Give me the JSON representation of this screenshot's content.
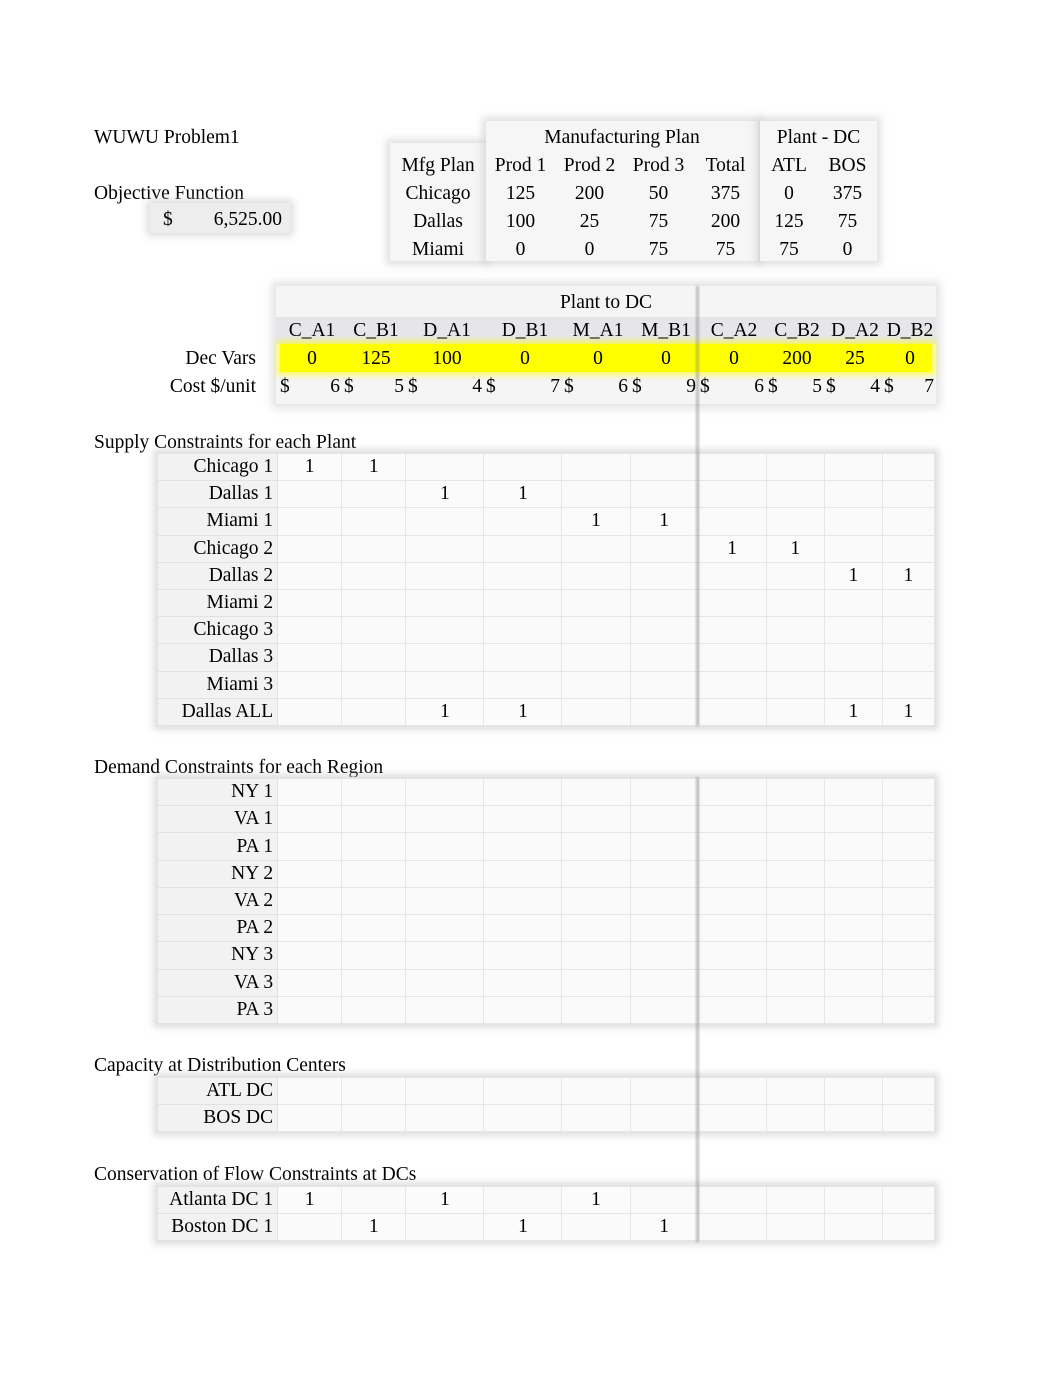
{
  "document": {
    "title": "WUWU Problem1",
    "objective_label": "Objective Function",
    "objective_currency": "$",
    "objective_value": "6,525.00"
  },
  "manufacturing": {
    "group_title": "Manufacturing Plan",
    "plant_dc_title": "Plant - DC",
    "headers": [
      "Mfg Plan",
      "Prod 1",
      "Prod 2",
      "Prod 3",
      "Total",
      "ATL",
      "BOS"
    ],
    "rows": [
      {
        "plant": "Chicago",
        "prod1": "125",
        "prod2": "200",
        "prod3": "50",
        "total": "375",
        "atl": "0",
        "bos": "375"
      },
      {
        "plant": "Dallas",
        "prod1": "100",
        "prod2": "25",
        "prod3": "75",
        "total": "200",
        "atl": "125",
        "bos": "75"
      },
      {
        "plant": "Miami",
        "prod1": "0",
        "prod2": "0",
        "prod3": "75",
        "total": "75",
        "atl": "75",
        "bos": "0"
      }
    ]
  },
  "plant_to_dc": {
    "group_title": "Plant to DC",
    "columns": [
      "C_A1",
      "C_B1",
      "D_A1",
      "D_B1",
      "M_A1",
      "M_B1",
      "C_A2",
      "C_B2",
      "D_A2",
      "D_B2"
    ],
    "dec_vars_label": "Dec Vars",
    "dec_vars": [
      "0",
      "125",
      "100",
      "0",
      "0",
      "0",
      "0",
      "200",
      "25",
      "0"
    ],
    "cost_label": "Cost $/unit",
    "cost_currency": "$",
    "costs": [
      "6",
      "5",
      "4",
      "7",
      "6",
      "9",
      "6",
      "5",
      "4",
      "7"
    ],
    "highlight_color": "#ffff00"
  },
  "supply": {
    "title": "Supply Constraints for each Plant",
    "rows": [
      {
        "label": "Chicago 1",
        "cells": [
          "1",
          "1",
          "",
          "",
          "",
          "",
          "",
          "",
          "",
          ""
        ]
      },
      {
        "label": "Dallas 1",
        "cells": [
          "",
          "",
          "1",
          "1",
          "",
          "",
          "",
          "",
          "",
          ""
        ]
      },
      {
        "label": "Miami 1",
        "cells": [
          "",
          "",
          "",
          "",
          "1",
          "1",
          "",
          "",
          "",
          ""
        ]
      },
      {
        "label": "Chicago 2",
        "cells": [
          "",
          "",
          "",
          "",
          "",
          "",
          "1",
          "1",
          "",
          ""
        ]
      },
      {
        "label": "Dallas 2",
        "cells": [
          "",
          "",
          "",
          "",
          "",
          "",
          "",
          "",
          "1",
          "1"
        ]
      },
      {
        "label": "Miami 2",
        "cells": [
          "",
          "",
          "",
          "",
          "",
          "",
          "",
          "",
          "",
          ""
        ]
      },
      {
        "label": "Chicago 3",
        "cells": [
          "",
          "",
          "",
          "",
          "",
          "",
          "",
          "",
          "",
          ""
        ]
      },
      {
        "label": "Dallas 3",
        "cells": [
          "",
          "",
          "",
          "",
          "",
          "",
          "",
          "",
          "",
          ""
        ]
      },
      {
        "label": "Miami 3",
        "cells": [
          "",
          "",
          "",
          "",
          "",
          "",
          "",
          "",
          "",
          ""
        ]
      },
      {
        "label": "Dallas ALL",
        "cells": [
          "",
          "",
          "1",
          "1",
          "",
          "",
          "",
          "",
          "1",
          "1"
        ]
      }
    ]
  },
  "demand": {
    "title": "Demand Constraints for each Region",
    "rows": [
      {
        "label": "NY 1",
        "cells": [
          "",
          "",
          "",
          "",
          "",
          "",
          "",
          "",
          "",
          ""
        ]
      },
      {
        "label": "VA  1",
        "cells": [
          "",
          "",
          "",
          "",
          "",
          "",
          "",
          "",
          "",
          ""
        ]
      },
      {
        "label": "PA 1",
        "cells": [
          "",
          "",
          "",
          "",
          "",
          "",
          "",
          "",
          "",
          ""
        ]
      },
      {
        "label": "NY 2",
        "cells": [
          "",
          "",
          "",
          "",
          "",
          "",
          "",
          "",
          "",
          ""
        ]
      },
      {
        "label": "VA  2",
        "cells": [
          "",
          "",
          "",
          "",
          "",
          "",
          "",
          "",
          "",
          ""
        ]
      },
      {
        "label": "PA 2",
        "cells": [
          "",
          "",
          "",
          "",
          "",
          "",
          "",
          "",
          "",
          ""
        ]
      },
      {
        "label": "NY 3",
        "cells": [
          "",
          "",
          "",
          "",
          "",
          "",
          "",
          "",
          "",
          ""
        ]
      },
      {
        "label": "VA  3",
        "cells": [
          "",
          "",
          "",
          "",
          "",
          "",
          "",
          "",
          "",
          ""
        ]
      },
      {
        "label": "PA 3",
        "cells": [
          "",
          "",
          "",
          "",
          "",
          "",
          "",
          "",
          "",
          ""
        ]
      }
    ]
  },
  "capacity": {
    "title": "Capacity at Distribution Centers",
    "rows": [
      {
        "label": "ATL DC",
        "cells": [
          "",
          "",
          "",
          "",
          "",
          "",
          "",
          "",
          "",
          ""
        ]
      },
      {
        "label": "BOS DC",
        "cells": [
          "",
          "",
          "",
          "",
          "",
          "",
          "",
          "",
          "",
          ""
        ]
      }
    ]
  },
  "conservation": {
    "title": "Conservation of Flow Constraints at DCs",
    "rows": [
      {
        "label": "Atlanta DC 1",
        "cells": [
          "1",
          "",
          "1",
          "",
          "1",
          "",
          "",
          "",
          "",
          ""
        ]
      },
      {
        "label": "Boston DC 1",
        "cells": [
          "",
          "1",
          "",
          "1",
          "",
          "1",
          "",
          "",
          "",
          ""
        ]
      }
    ]
  }
}
